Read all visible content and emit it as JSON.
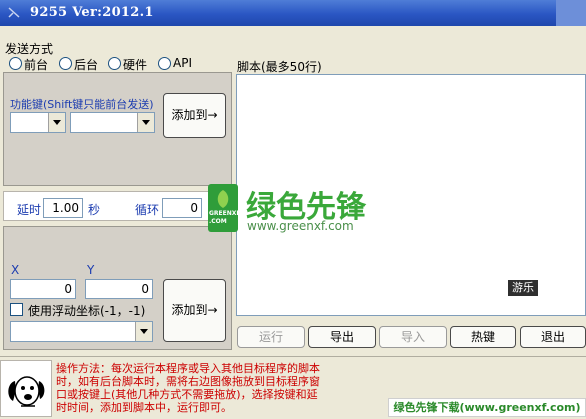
{
  "window": {
    "title": "9255  Ver:2012.1"
  },
  "send_mode": {
    "label": "发送方式",
    "options": [
      "前台",
      "后台",
      "硬件",
      "API"
    ]
  },
  "function_keys": {
    "label": "功能键(Shift键只能前台发送)",
    "add_button": "添加到→"
  },
  "delay": {
    "label": "延时",
    "value": "1.00",
    "unit": "秒"
  },
  "loop": {
    "label": "循环",
    "value": "0"
  },
  "coords": {
    "x_label": "X",
    "y_label": "Y",
    "x_value": "0",
    "y_value": "0",
    "float_checkbox_label": "使用浮动坐标(-1，-1)",
    "add_button": "添加到→"
  },
  "script": {
    "label": "脚本(最多50行)",
    "tooltip": "游乐"
  },
  "actions": [
    "运行",
    "导出",
    "导入",
    "热键",
    "退出"
  ],
  "instructions": {
    "text": "操作方法：每次运行本程序或导入其他目标程序的脚本时，如有后台脚本时，需将右边图像拖放到目标程序窗口或按键上(其他几种方式不需要拖放)，选择按键和延时时间，添加到脚本中，运行即可。"
  },
  "watermark": {
    "name": "绿色先锋",
    "url": "www.greenxf.com",
    "badge_text": "GREENXF .COM"
  },
  "footer_banner": "绿色先锋下载(www.greenxf.com)",
  "colors": {
    "title_bar": "#2a56c3",
    "instructions_text": "#cc0000",
    "label_blue": "#1c3cb0",
    "watermark_green": "#3aa83a"
  }
}
